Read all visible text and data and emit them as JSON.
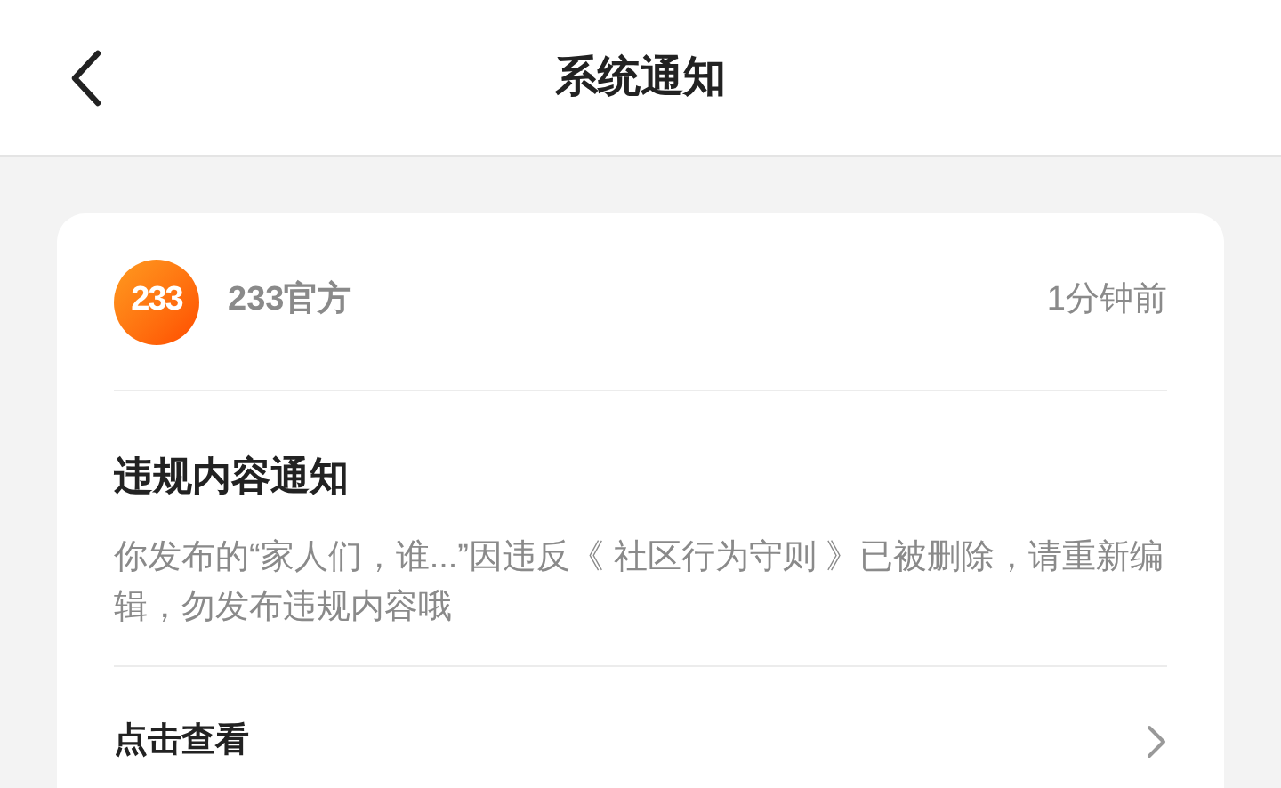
{
  "header": {
    "title": "系统通知"
  },
  "notification": {
    "logo_text": "233",
    "sender": "233官方",
    "time": "1分钟前",
    "title": "违规内容通知",
    "body": "你发布的“家人们，谁...”因违反《 社区行为守则 》已被删除，请重新编辑，勿发布违规内容哦",
    "action": "点击查看"
  }
}
